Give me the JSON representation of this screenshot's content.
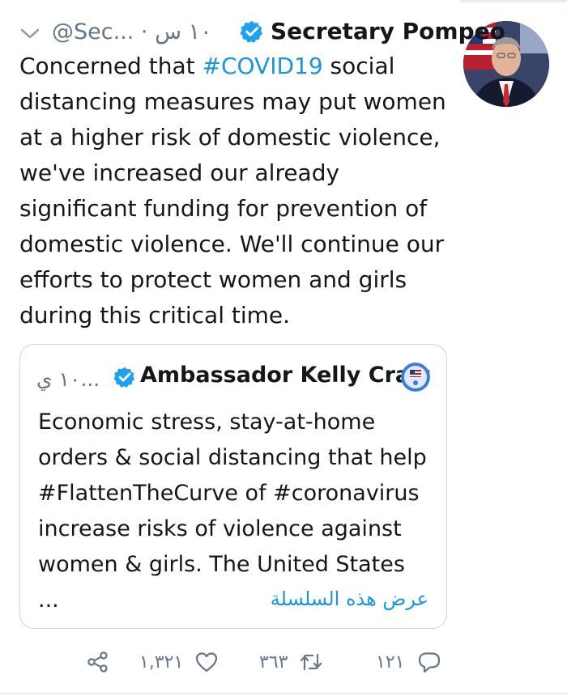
{
  "tweet": {
    "display_name": "Secretary Pompeo",
    "handle_time": "@Sec... · ١٠ س",
    "verified_icon": "verified-badge-icon",
    "avatar_icon": "profile-photo",
    "menu_icon": "chevron-down-icon",
    "text_before": "Concerned that ",
    "hashtag": "#COVID19",
    "text_after": " social distancing measures may put women at a higher risk of domestic violence, we've increased our already significant funding for prevention of domestic violence. We'll continue our efforts to protect women and girls during this critical time."
  },
  "quote": {
    "display_name": "Ambassador Kelly Craft",
    "meta": "١٠ ي...",
    "verified_icon": "verified-badge-icon",
    "avatar_icon": "usun-seal-avatar",
    "text": "Economic stress, stay-at-home orders & social distancing that help #FlattenTheCurve of #coronavirus increase risks of violence against women & girls. The United States ...",
    "show_thread": "عرض هذه السلسلة"
  },
  "actions": {
    "reply_count": "١٢١",
    "retweet_count": "٣٦٣",
    "like_count": "١,٣٢١",
    "share_icon": "share-icon",
    "like_icon": "heart-icon",
    "retweet_icon": "retweet-icon",
    "reply_icon": "reply-icon"
  },
  "colors": {
    "link": "#1b95e0",
    "secondary_text": "#657786",
    "border": "#ccd6dd"
  }
}
